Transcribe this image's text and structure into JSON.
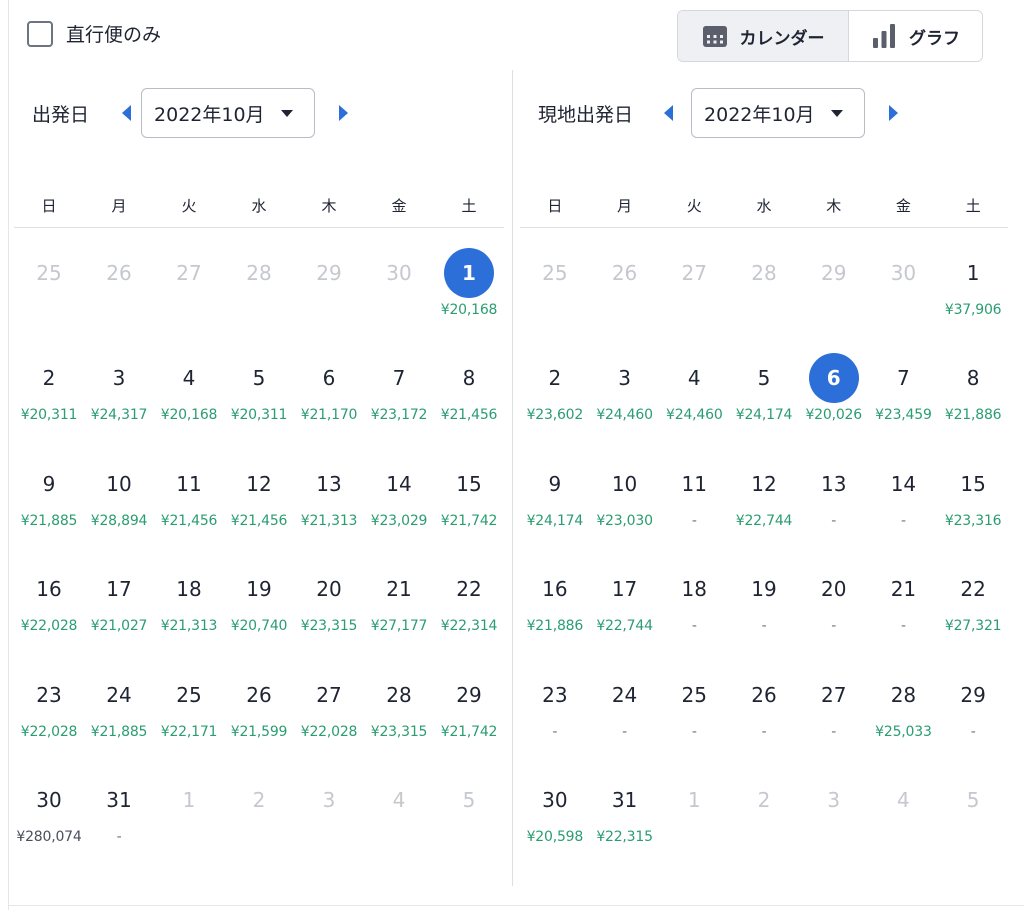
{
  "filter": {
    "direct_only_label": "直行便のみ"
  },
  "view_toggle": {
    "calendar_label": "カレンダー",
    "graph_label": "グラフ"
  },
  "weekdays": [
    "日",
    "月",
    "火",
    "水",
    "木",
    "金",
    "土"
  ],
  "colors": {
    "accent": "#2d6fd9",
    "price": "#2a9d72"
  },
  "departure": {
    "title": "出発日",
    "month": "2022年10月",
    "days": [
      {
        "d": "25",
        "p": "",
        "dim": true
      },
      {
        "d": "26",
        "p": "",
        "dim": true
      },
      {
        "d": "27",
        "p": "",
        "dim": true
      },
      {
        "d": "28",
        "p": "",
        "dim": true
      },
      {
        "d": "29",
        "p": "",
        "dim": true
      },
      {
        "d": "30",
        "p": "",
        "dim": true
      },
      {
        "d": "1",
        "p": "¥20,168",
        "sel": true
      },
      {
        "d": "2",
        "p": "¥20,311"
      },
      {
        "d": "3",
        "p": "¥24,317"
      },
      {
        "d": "4",
        "p": "¥20,168"
      },
      {
        "d": "5",
        "p": "¥20,311"
      },
      {
        "d": "6",
        "p": "¥21,170"
      },
      {
        "d": "7",
        "p": "¥23,172"
      },
      {
        "d": "8",
        "p": "¥21,456"
      },
      {
        "d": "9",
        "p": "¥21,885"
      },
      {
        "d": "10",
        "p": "¥28,894"
      },
      {
        "d": "11",
        "p": "¥21,456"
      },
      {
        "d": "12",
        "p": "¥21,456"
      },
      {
        "d": "13",
        "p": "¥21,313"
      },
      {
        "d": "14",
        "p": "¥23,029"
      },
      {
        "d": "15",
        "p": "¥21,742"
      },
      {
        "d": "16",
        "p": "¥22,028"
      },
      {
        "d": "17",
        "p": "¥21,027"
      },
      {
        "d": "18",
        "p": "¥21,313"
      },
      {
        "d": "19",
        "p": "¥20,740"
      },
      {
        "d": "20",
        "p": "¥23,315"
      },
      {
        "d": "21",
        "p": "¥27,177"
      },
      {
        "d": "22",
        "p": "¥22,314"
      },
      {
        "d": "23",
        "p": "¥22,028"
      },
      {
        "d": "24",
        "p": "¥21,885"
      },
      {
        "d": "25",
        "p": "¥22,171"
      },
      {
        "d": "26",
        "p": "¥21,599"
      },
      {
        "d": "27",
        "p": "¥22,028"
      },
      {
        "d": "28",
        "p": "¥23,315"
      },
      {
        "d": "29",
        "p": "¥21,742"
      },
      {
        "d": "30",
        "p": "¥280,074",
        "high": true
      },
      {
        "d": "31",
        "p": "-"
      },
      {
        "d": "1",
        "p": "",
        "dim": true
      },
      {
        "d": "2",
        "p": "",
        "dim": true
      },
      {
        "d": "3",
        "p": "",
        "dim": true
      },
      {
        "d": "4",
        "p": "",
        "dim": true
      },
      {
        "d": "5",
        "p": "",
        "dim": true
      }
    ]
  },
  "return": {
    "title": "現地出発日",
    "month": "2022年10月",
    "days": [
      {
        "d": "25",
        "p": "",
        "dim": true
      },
      {
        "d": "26",
        "p": "",
        "dim": true
      },
      {
        "d": "27",
        "p": "",
        "dim": true
      },
      {
        "d": "28",
        "p": "",
        "dim": true
      },
      {
        "d": "29",
        "p": "",
        "dim": true
      },
      {
        "d": "30",
        "p": "",
        "dim": true
      },
      {
        "d": "1",
        "p": "¥37,906"
      },
      {
        "d": "2",
        "p": "¥23,602"
      },
      {
        "d": "3",
        "p": "¥24,460"
      },
      {
        "d": "4",
        "p": "¥24,460"
      },
      {
        "d": "5",
        "p": "¥24,174"
      },
      {
        "d": "6",
        "p": "¥20,026",
        "sel": true
      },
      {
        "d": "7",
        "p": "¥23,459"
      },
      {
        "d": "8",
        "p": "¥21,886"
      },
      {
        "d": "9",
        "p": "¥24,174"
      },
      {
        "d": "10",
        "p": "¥23,030"
      },
      {
        "d": "11",
        "p": "-"
      },
      {
        "d": "12",
        "p": "¥22,744"
      },
      {
        "d": "13",
        "p": "-"
      },
      {
        "d": "14",
        "p": "-"
      },
      {
        "d": "15",
        "p": "¥23,316"
      },
      {
        "d": "16",
        "p": "¥21,886"
      },
      {
        "d": "17",
        "p": "¥22,744"
      },
      {
        "d": "18",
        "p": "-"
      },
      {
        "d": "19",
        "p": "-"
      },
      {
        "d": "20",
        "p": "-"
      },
      {
        "d": "21",
        "p": "-"
      },
      {
        "d": "22",
        "p": "¥27,321"
      },
      {
        "d": "23",
        "p": "-"
      },
      {
        "d": "24",
        "p": "-"
      },
      {
        "d": "25",
        "p": "-"
      },
      {
        "d": "26",
        "p": "-"
      },
      {
        "d": "27",
        "p": "-"
      },
      {
        "d": "28",
        "p": "¥25,033"
      },
      {
        "d": "29",
        "p": "-"
      },
      {
        "d": "30",
        "p": "¥20,598"
      },
      {
        "d": "31",
        "p": "¥22,315"
      },
      {
        "d": "1",
        "p": "",
        "dim": true
      },
      {
        "d": "2",
        "p": "",
        "dim": true
      },
      {
        "d": "3",
        "p": "",
        "dim": true
      },
      {
        "d": "4",
        "p": "",
        "dim": true
      },
      {
        "d": "5",
        "p": "",
        "dim": true
      }
    ]
  }
}
